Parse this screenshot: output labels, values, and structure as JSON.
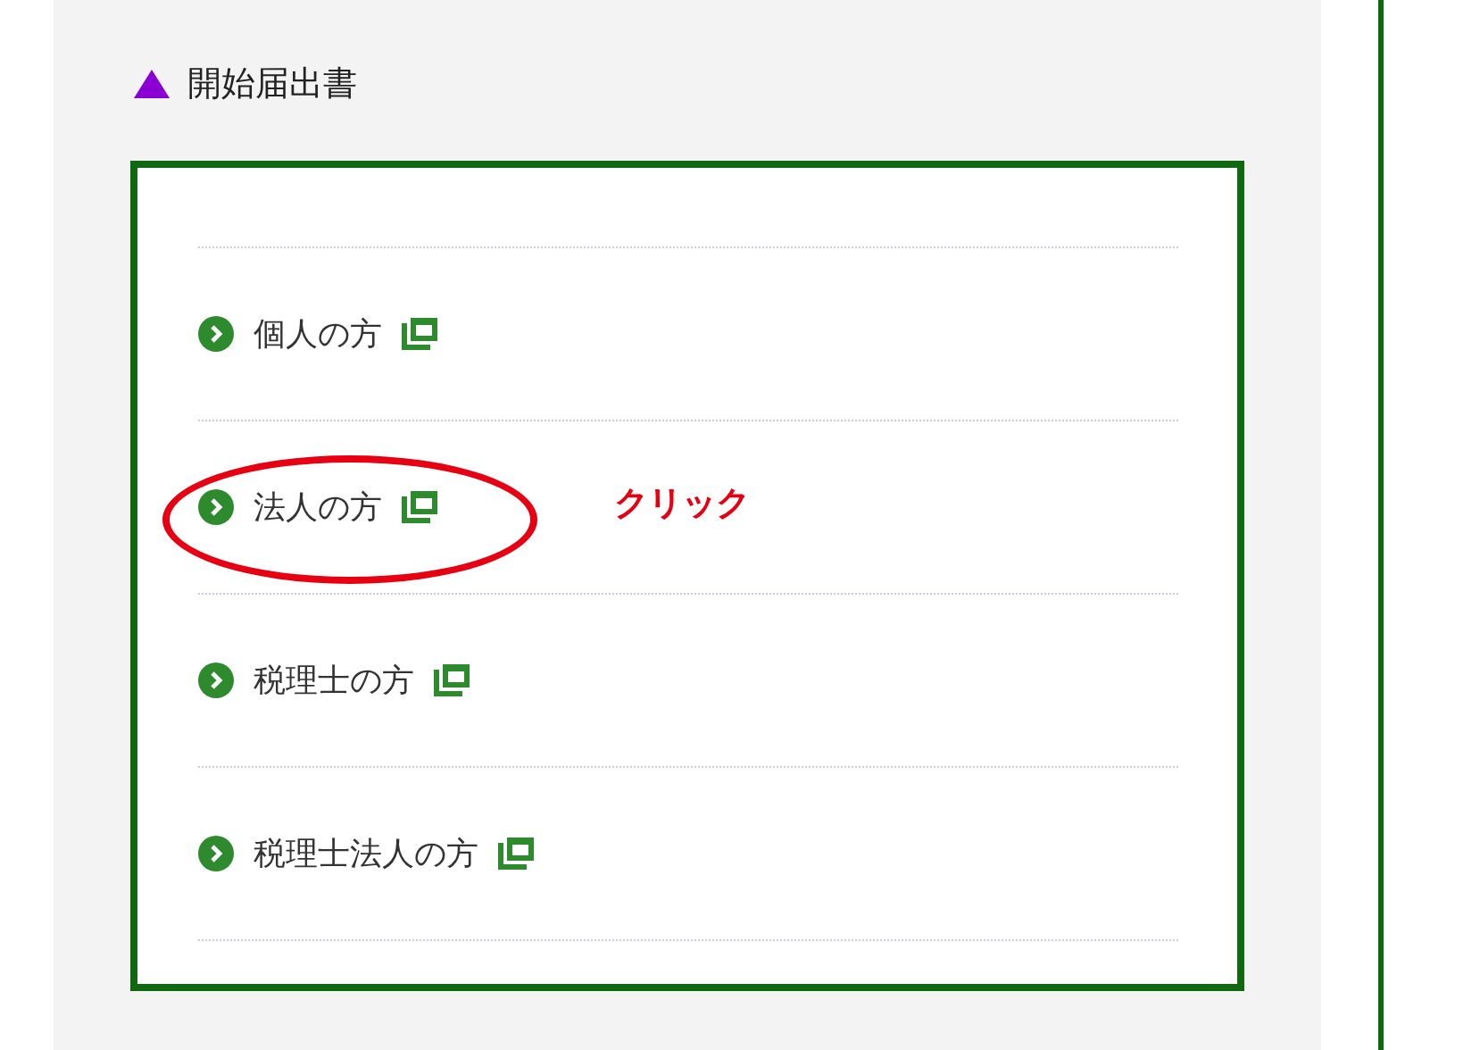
{
  "section": {
    "title": "開始届出書",
    "expanded": true
  },
  "items": [
    {
      "label": "個人の方",
      "circled": false
    },
    {
      "label": "法人の方",
      "circled": true
    },
    {
      "label": "税理士の方",
      "circled": false
    },
    {
      "label": "税理士法人の方",
      "circled": false
    }
  ],
  "annotation": {
    "text": "クリック"
  }
}
